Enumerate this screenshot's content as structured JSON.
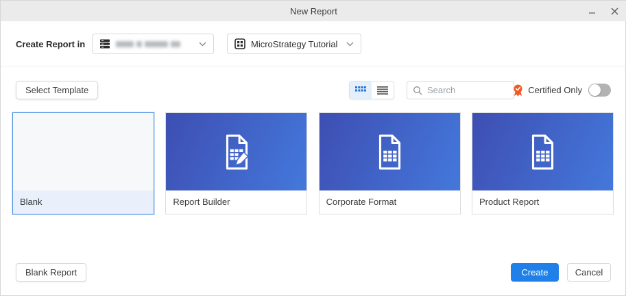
{
  "titlebar": {
    "title": "New Report"
  },
  "row1": {
    "label": "Create Report in",
    "server_dropdown": {
      "value_redacted": true
    },
    "project_dropdown": {
      "value": "MicroStrategy Tutorial"
    }
  },
  "row2": {
    "select_template_label": "Select Template",
    "view_mode": "grid",
    "search_placeholder": "Search",
    "certified_only_label": "Certified Only",
    "certified_toggle_state": "off"
  },
  "templates": [
    {
      "name": "Blank",
      "selected": true,
      "icon": "none"
    },
    {
      "name": "Report Builder",
      "selected": false,
      "icon": "document-grid-pencil"
    },
    {
      "name": "Corporate Format",
      "selected": false,
      "icon": "document-grid"
    },
    {
      "name": "Product Report",
      "selected": false,
      "icon": "document-grid"
    }
  ],
  "footer": {
    "blank_report_label": "Blank Report",
    "create_label": "Create",
    "cancel_label": "Cancel"
  },
  "colors": {
    "accent_blue": "#1e80e8",
    "selected_border": "#4a90e2",
    "card_gradient_start": "#3e4eb2",
    "card_gradient_end": "#4478dc",
    "certified_orange": "#ee5b25",
    "titlebar_bg": "#ebebeb"
  }
}
